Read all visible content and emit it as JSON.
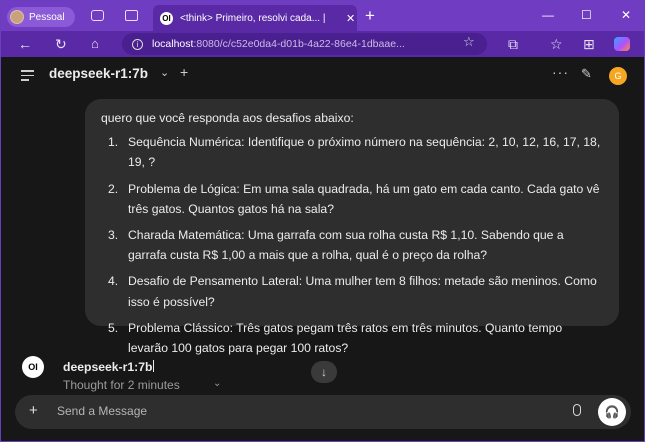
{
  "browser": {
    "profile_label": "Pessoal",
    "tab_title": "<think> Primeiro, resolvi cada... |",
    "tab_close": "✕",
    "new_tab": "+",
    "url_host": "localhost",
    "url_path": ":8080/c/c52e0da4-d01b-4a22-86e4-1dbaae...",
    "icons": [
      "back-icon",
      "refresh-icon",
      "home-icon",
      "info-icon",
      "favorite-star-icon",
      "extensions-icon",
      "collections-icon",
      "favorites-icon",
      "copilot-icon"
    ],
    "window_controls": {
      "minimize": "—",
      "maximize": "☐",
      "close": "✕"
    }
  },
  "header": {
    "model_name": "deepseek-r1:7b",
    "user_initial": "G"
  },
  "user_message": {
    "intro": "quero que você responda aos desafios abaixo:",
    "items": [
      {
        "num": "1.",
        "text": "Sequência Numérica: Identifique o próximo número na sequência: 2, 10, 12, 16, 17, 18, 19, ?"
      },
      {
        "num": "2.",
        "text": "Problema de Lógica: Em uma sala quadrada, há um gato em cada canto. Cada gato vê três gatos. Quantos gatos há na sala?"
      },
      {
        "num": "3.",
        "text": "Charada Matemática: Uma garrafa com sua rolha custa R$ 1,10. Sabendo que a garrafa custa R$ 1,00 a mais que a rolha, qual é o preço da rolha?"
      },
      {
        "num": "4.",
        "text": "Desafio de Pensamento Lateral: Uma mulher tem 8 filhos: metade são meninos. Como isso é possível?"
      },
      {
        "num": "5.",
        "text": "Problema Clássico: Três gatos pegam três ratos em três minutos. Quanto tempo levarão 100 gatos para pegar 100 ratos?"
      }
    ]
  },
  "assistant": {
    "name": "deepseek-r1:7b",
    "thought_label": "Thought for 2 minutes"
  },
  "composer": {
    "placeholder": "Send a Message"
  }
}
